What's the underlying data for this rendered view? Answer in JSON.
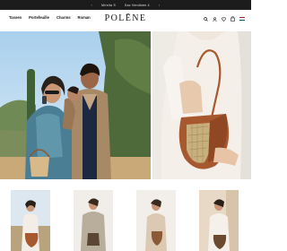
{
  "promo": {
    "message": "Mirella S",
    "message2": "Sac Vendôme 4",
    "prev_icon": "chevron-left-icon",
    "next_icon": "chevron-right-icon"
  },
  "nav": {
    "links": [
      "Tassen",
      "Portefeuille",
      "Charms",
      "Roman"
    ],
    "brand": "POLĒNE",
    "icons": [
      "search-icon",
      "user-icon",
      "heart-icon",
      "bag-icon",
      "flag-icon"
    ]
  },
  "colors": {
    "promo_bg": "#1c1c1c",
    "text": "#1a1a1a",
    "leather": "#a8582e",
    "sky": "#b9d8ee"
  }
}
